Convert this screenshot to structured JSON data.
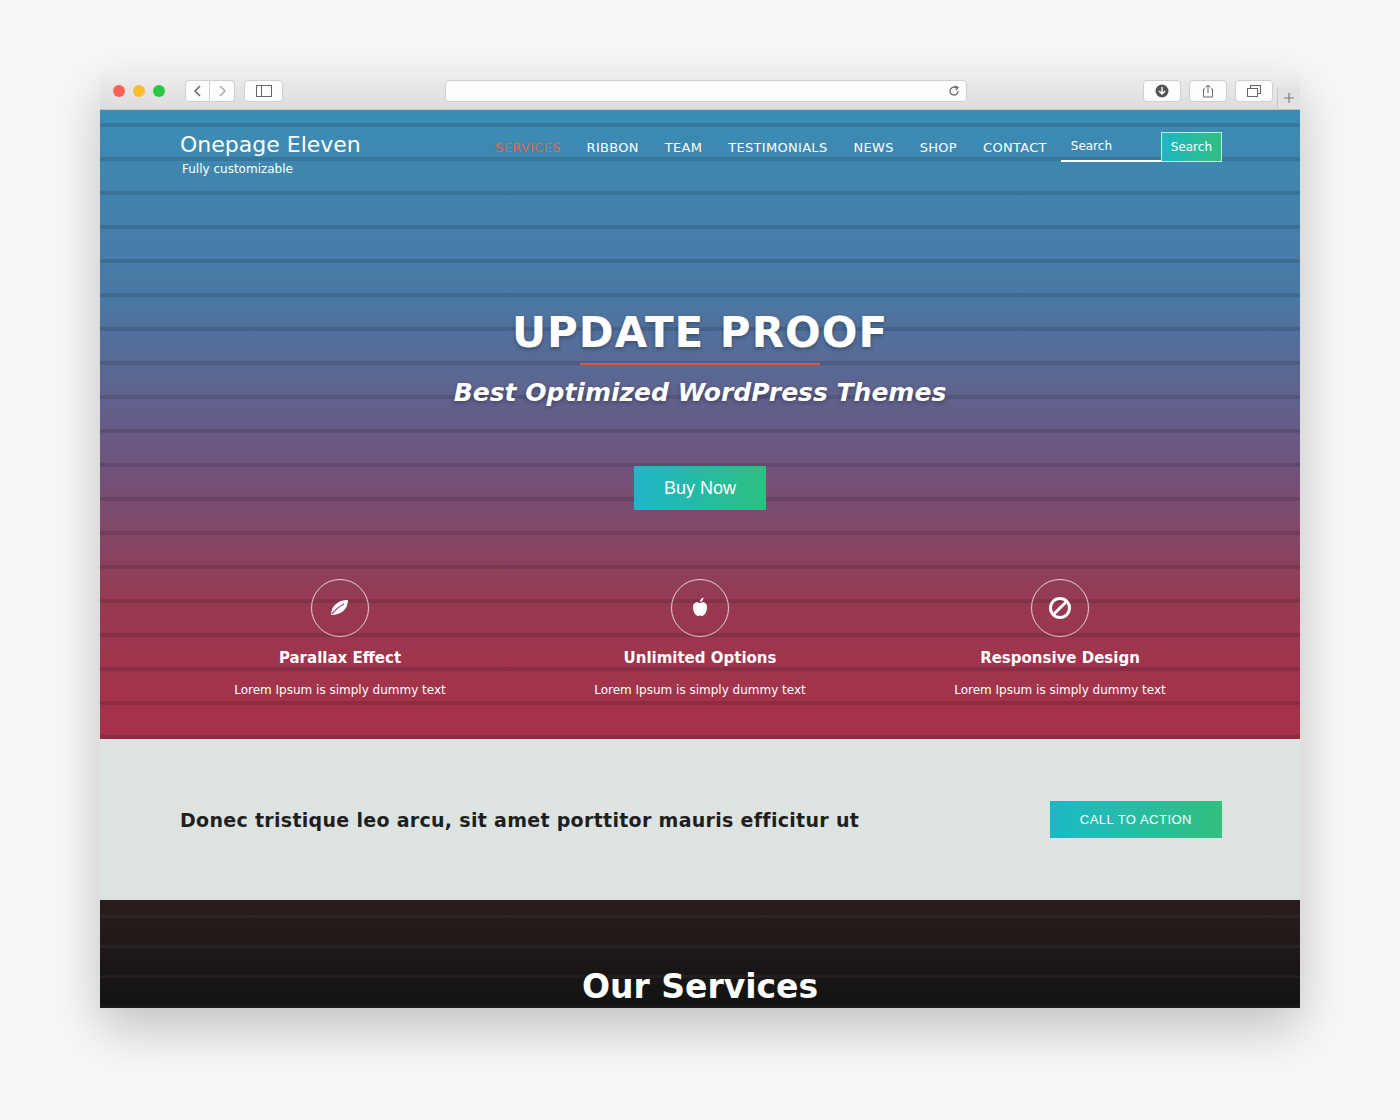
{
  "site": {
    "logo": "Onepage Eleven",
    "tagline": "Fully customizable"
  },
  "nav": [
    {
      "label": "SERVICES",
      "selected": true
    },
    {
      "label": "RIBBON",
      "selected": false
    },
    {
      "label": "TEAM",
      "selected": false
    },
    {
      "label": "TESTIMONIALS",
      "selected": false
    },
    {
      "label": "NEWS",
      "selected": false
    },
    {
      "label": "SHOP",
      "selected": false
    },
    {
      "label": "CONTACT",
      "selected": false
    }
  ],
  "search": {
    "placeholder": "Search",
    "button": "Search"
  },
  "hero": {
    "title": "UPDATE PROOF",
    "subtitle": "Best Optimized WordPress Themes",
    "button": "Buy Now"
  },
  "features": [
    {
      "title": "Parallax Effect",
      "text": "Lorem Ipsum is simply dummy text"
    },
    {
      "title": "Unlimited Options",
      "text": "Lorem Ipsum is simply dummy text"
    },
    {
      "title": "Responsive Design",
      "text": "Lorem Ipsum is simply dummy text"
    }
  ],
  "cta": {
    "text": "Donec tristique leo arcu, sit amet porttitor mauris efficitur ut",
    "button": "CALL TO ACTION"
  },
  "services": {
    "title": "Our Services"
  }
}
